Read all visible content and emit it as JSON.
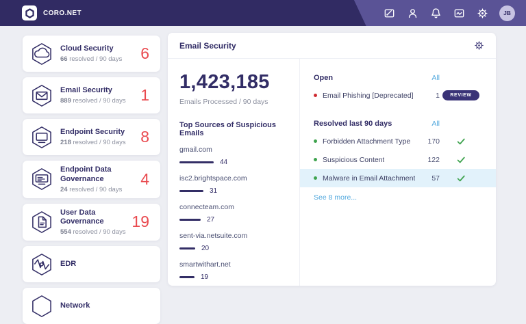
{
  "topbar": {
    "brand": "CORO.NET",
    "icons": [
      "compose-icon",
      "users-icon",
      "bell-icon",
      "activity-icon",
      "settings-icon"
    ],
    "avatar_initials": "JB"
  },
  "sidebar": {
    "modules": [
      {
        "name": "Cloud Security",
        "icon": "cloud-hexagon-icon",
        "resolved": "66",
        "period": "resolved / 90 days",
        "count": "6"
      },
      {
        "name": "Email Security",
        "icon": "envelope-hexagon-icon",
        "resolved": "889",
        "period": "resolved / 90 days",
        "count": "1"
      },
      {
        "name": "Endpoint Security",
        "icon": "monitor-hexagon-icon",
        "resolved": "218",
        "period": "resolved / 90 days",
        "count": "8"
      },
      {
        "name": "Endpoint Data Governance",
        "icon": "monitor-data-hexagon-icon",
        "resolved": "24",
        "period": "resolved / 90 days",
        "count": "4"
      },
      {
        "name": "User Data Governance",
        "icon": "document-hexagon-icon",
        "resolved": "554",
        "period": "resolved / 90 days",
        "count": "19"
      },
      {
        "name": "EDR",
        "icon": "pulse-hexagon-icon"
      },
      {
        "name": "Network",
        "icon": "hexagon-icon"
      }
    ]
  },
  "panel": {
    "title": "Email Security",
    "emails_processed": "1,423,185",
    "emails_processed_label": "Emails Processed / 90 days",
    "top_sources": {
      "title": "Top Sources of Suspicious Emails",
      "max_value": 44,
      "items": [
        {
          "domain": "gmail.com",
          "value": 44
        },
        {
          "domain": "isc2.brightspace.com",
          "value": 31
        },
        {
          "domain": "connecteam.com",
          "value": 27
        },
        {
          "domain": "sent-via.netsuite.com",
          "value": 20
        },
        {
          "domain": "smartwithart.net",
          "value": 19
        }
      ]
    },
    "tickets": {
      "open": {
        "title": "Open",
        "all_label": "All",
        "items": [
          {
            "label": "Email Phishing [Deprecated]",
            "count": "1",
            "dot": "red",
            "action": "REVIEW"
          }
        ]
      },
      "resolved": {
        "title": "Resolved last 90 days",
        "all_label": "All",
        "items": [
          {
            "label": "Forbidden Attachment Type",
            "count": "170",
            "dot": "green"
          },
          {
            "label": "Suspicious Content",
            "count": "122",
            "dot": "green"
          },
          {
            "label": "Malware in Email Attachment",
            "count": "57",
            "dot": "green",
            "highlighted": true
          }
        ]
      },
      "see_more": "See 8 more..."
    }
  },
  "colors": {
    "topbar_dark": "#312b63",
    "topbar_light": "#5a5396",
    "navy_text": "#322d66",
    "alert_red": "#e94a4f",
    "link_blue": "#53a9de",
    "success_green": "#3ea34e",
    "row_highlight": "#e2f2fb",
    "page_background": "#edeef3"
  }
}
